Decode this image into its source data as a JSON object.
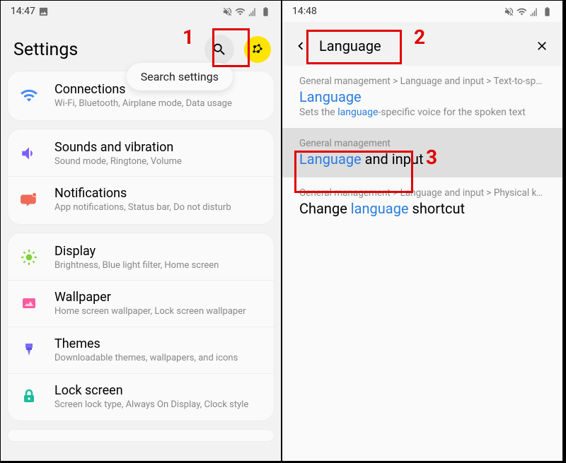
{
  "colors": {
    "accent": "#2a7de1",
    "marker": "#e10000",
    "bg": "#f2f2f2"
  },
  "left": {
    "time": "14:47",
    "title": "Settings",
    "tooltip": "Search settings",
    "items": [
      {
        "icon": "wifi",
        "color": "#4a8af4",
        "title": "Connections",
        "sub": "Wi-Fi, Bluetooth, Airplane mode, Data usage"
      },
      {
        "icon": "sound",
        "color": "#7f5eff",
        "title": "Sounds and vibration",
        "sub": "Sound mode, Ringtone, Volume"
      },
      {
        "icon": "notif",
        "color": "#ef6a57",
        "title": "Notifications",
        "sub": "App notifications, Status bar, Do not disturb"
      },
      {
        "icon": "display",
        "color": "#7fd133",
        "title": "Display",
        "sub": "Brightness, Blue light filter, Home screen"
      },
      {
        "icon": "wallpaper",
        "color": "#f85ca0",
        "title": "Wallpaper",
        "sub": "Home screen wallpaper, Lock screen wallpaper"
      },
      {
        "icon": "themes",
        "color": "#7a6bff",
        "title": "Themes",
        "sub": "Downloadable themes, wallpapers, and icons"
      },
      {
        "icon": "lock",
        "color": "#1bbc9b",
        "title": "Lock screen",
        "sub": "Screen lock type, Always On Display, Clock style"
      }
    ]
  },
  "right": {
    "time": "14:48",
    "query": "Language",
    "results": [
      {
        "path": "General management > Language and input > Text-to-speech",
        "title_pre": "",
        "title_hl": "Language",
        "title_post": "",
        "sub_pre": "Sets the ",
        "sub_hl": "language",
        "sub_post": "-specific voice for the spoken text"
      },
      {
        "path": "General management",
        "title_pre": "",
        "title_hl": "Language",
        "title_post": " and input",
        "sub_pre": "",
        "sub_hl": "",
        "sub_post": ""
      },
      {
        "path": "General management > Language and input > Physical keybo…",
        "title_pre": "Change ",
        "title_hl": "language",
        "title_post": " shortcut",
        "sub_pre": "",
        "sub_hl": "",
        "sub_post": ""
      }
    ]
  },
  "markers": {
    "1": "1",
    "2": "2",
    "3": "3"
  }
}
